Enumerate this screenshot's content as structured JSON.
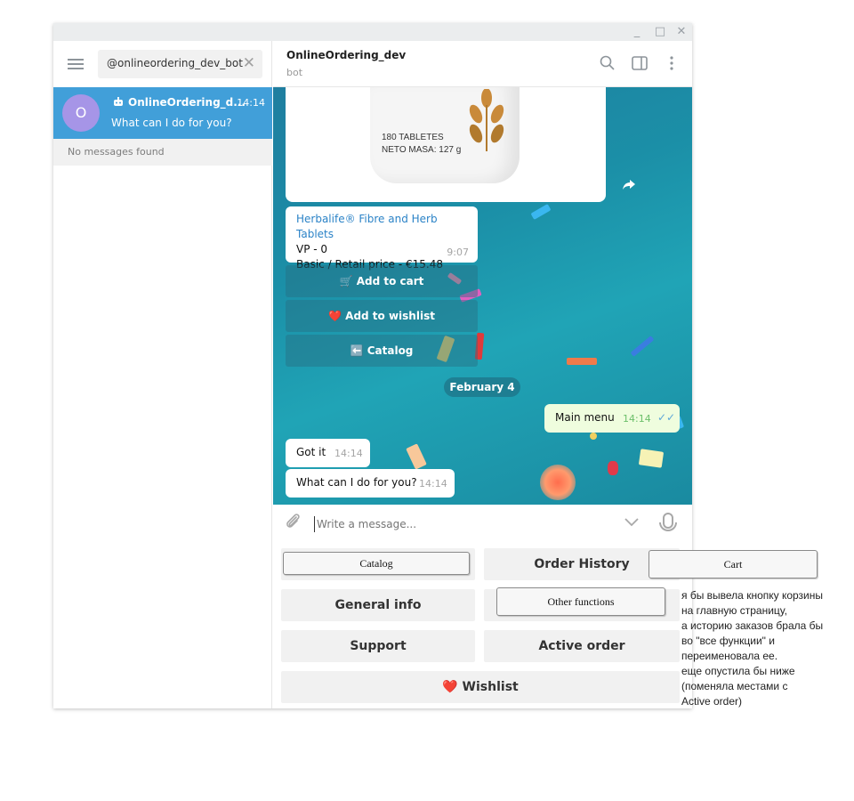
{
  "window": {
    "controls": {
      "minimize": "_",
      "maximize": "□",
      "close": "✕"
    }
  },
  "sidebar": {
    "search_value": "@onlineordering_dev_bot",
    "search_clear": "✕",
    "chat": {
      "avatar_letter": "O",
      "name": "OnlineOrdering_d...",
      "time": "14:14",
      "last_message": "What can I do for you?"
    },
    "empty_label": "No messages found"
  },
  "header": {
    "title": "OnlineOrdering_dev",
    "subtitle": "bot"
  },
  "chat": {
    "photo": {
      "label_line1": "180 TABLETES",
      "label_line2": "NETO MASA: 127 g"
    },
    "product": {
      "link": "Herbalife® Fibre and Herb Tablets",
      "line1": "VP - 0",
      "line2": "Basic / Retail price - €15.48",
      "time": "9:07"
    },
    "inline_buttons": [
      {
        "label": "🛒 Add to cart"
      },
      {
        "label": "❤️ Add to wishlist"
      },
      {
        "label": "⬅️ Catalog"
      }
    ],
    "date": "February 4",
    "messages": [
      {
        "text": "Main menu",
        "time": "14:14",
        "ticks": "✓✓"
      },
      {
        "text": "Got it",
        "time": "14:14"
      },
      {
        "text": "What can I do for you?",
        "time": "14:14"
      }
    ]
  },
  "composer": {
    "placeholder": "Write a message..."
  },
  "keyboard": {
    "order_history": "Order History",
    "general_info": "General info",
    "support": "Support",
    "active_order": "Active order",
    "wishlist": "❤️ Wishlist"
  },
  "overlay": {
    "catalog": "Catalog",
    "cart": "Cart",
    "other_functions": "Other functions"
  },
  "annotation": {
    "lines": [
      "я бы вывела кнопку корзины",
      " на главную страницу,",
      "а историю заказов брала бы",
      " во \"все функции\" и",
      "переименовала ее.",
      " еще опустила бы ниже",
      "(поменяла местами с",
      "Active order)"
    ]
  }
}
